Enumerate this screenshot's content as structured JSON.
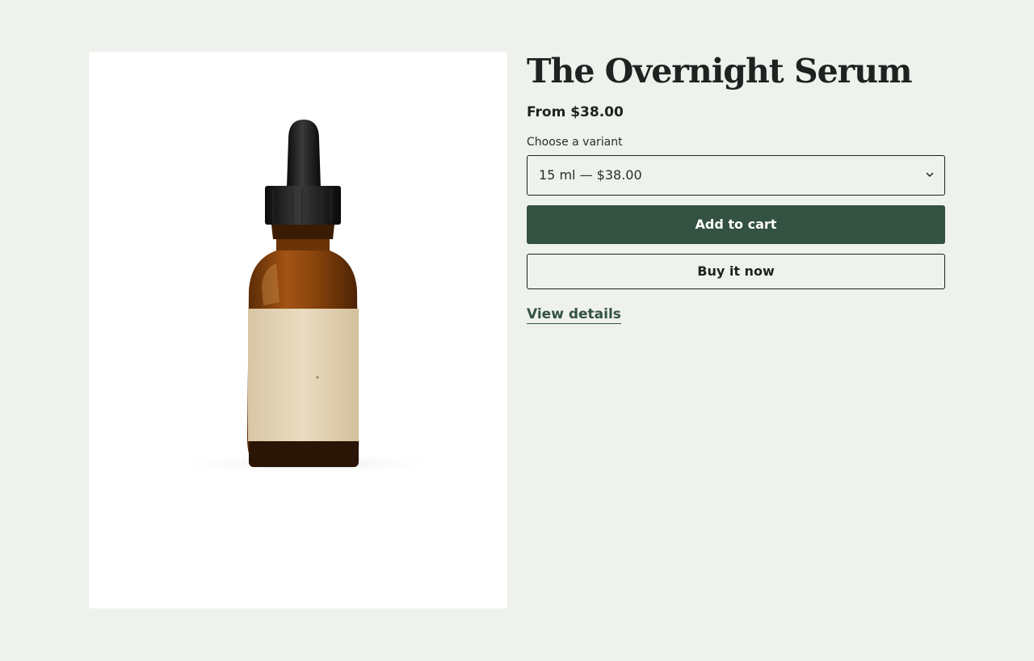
{
  "product": {
    "title": "The Overnight Serum",
    "price": "From $38.00",
    "image_alt": "Amber dropper bottle with blank kraft label"
  },
  "variant": {
    "label": "Choose a variant",
    "selected": "15 ml — $38.00",
    "chevron_icon": "chevron-down-icon"
  },
  "actions": {
    "add_to_cart": "Add to cart",
    "buy_now": "Buy it now",
    "view_details": "View details"
  },
  "colors": {
    "background": "#eef1ec",
    "accent": "#345242",
    "text": "#1c2320"
  }
}
